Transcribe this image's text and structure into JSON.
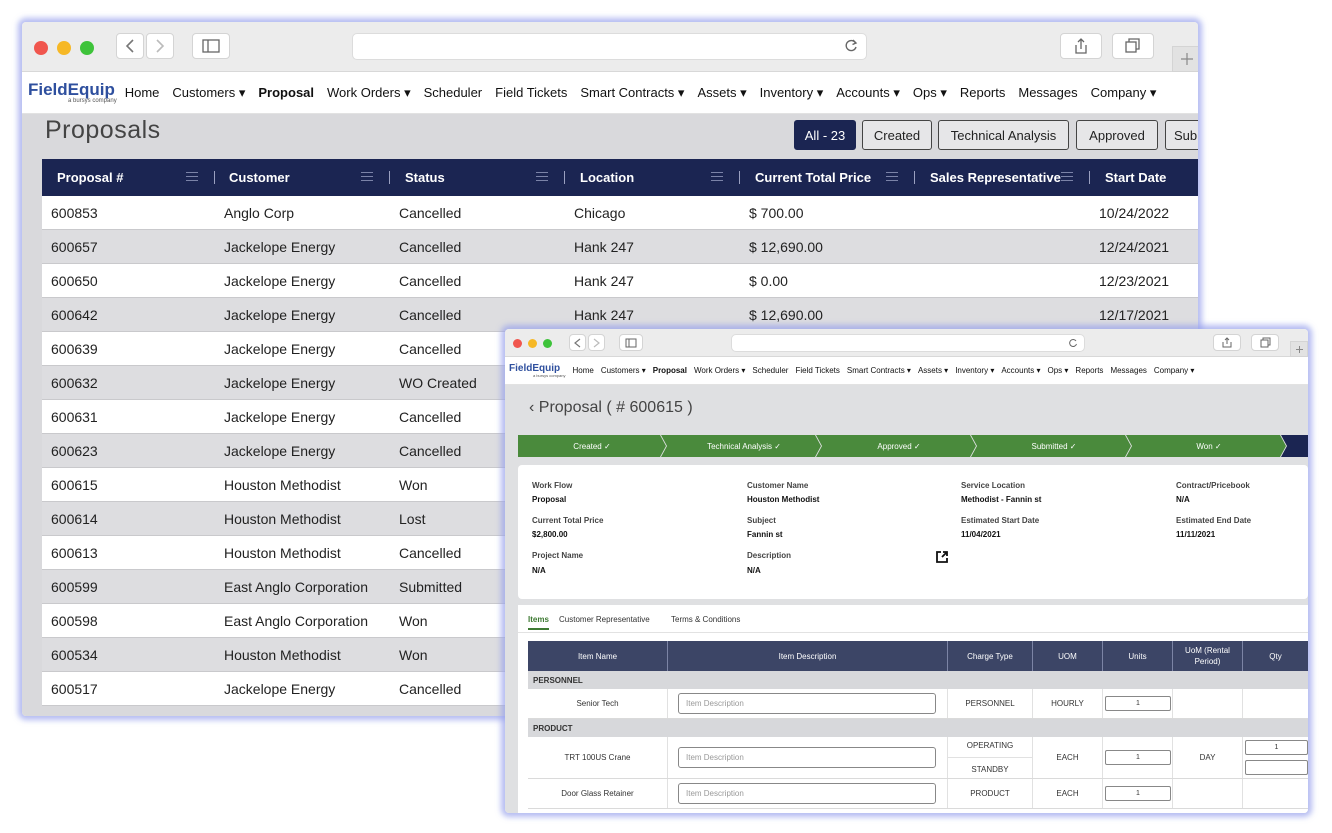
{
  "nav": {
    "logo": "FieldEquip",
    "logo_sub": "a bursys company",
    "items": [
      "Home",
      "Customers ▾",
      "Proposal",
      "Work Orders ▾",
      "Scheduler",
      "Field Tickets",
      "Smart Contracts ▾",
      "Assets ▾",
      "Inventory ▾",
      "Accounts ▾",
      "Ops ▾",
      "Reports",
      "Messages",
      "Company ▾"
    ],
    "active": "Proposal"
  },
  "list": {
    "title": "Proposals",
    "filters": [
      "All - 23",
      "Created",
      "Technical Analysis",
      "Approved",
      "Sub"
    ],
    "columns": [
      "Proposal #",
      "Customer",
      "Status",
      "Location",
      "Current Total Price",
      "Sales Representative",
      "Start Date"
    ],
    "rows": [
      [
        "600853",
        "Anglo Corp",
        "Cancelled",
        "Chicago",
        "$ 700.00",
        "",
        "10/24/2022"
      ],
      [
        "600657",
        "Jackelope Energy",
        "Cancelled",
        "Hank 247",
        "$ 12,690.00",
        "",
        "12/24/2021"
      ],
      [
        "600650",
        "Jackelope Energy",
        "Cancelled",
        "Hank 247",
        "$ 0.00",
        "",
        "12/23/2021"
      ],
      [
        "600642",
        "Jackelope Energy",
        "Cancelled",
        "Hank 247",
        "$ 12,690.00",
        "",
        "12/17/2021"
      ],
      [
        "600639",
        "Jackelope Energy",
        "Cancelled",
        "",
        "",
        "",
        ""
      ],
      [
        "600632",
        "Jackelope Energy",
        "WO Created",
        "",
        "",
        "",
        ""
      ],
      [
        "600631",
        "Jackelope Energy",
        "Cancelled",
        "",
        "",
        "",
        ""
      ],
      [
        "600623",
        "Jackelope Energy",
        "Cancelled",
        "",
        "",
        "",
        ""
      ],
      [
        "600615",
        "Houston Methodist",
        "Won",
        "",
        "",
        "",
        ""
      ],
      [
        "600614",
        "Houston Methodist",
        "Lost",
        "",
        "",
        "",
        ""
      ],
      [
        "600613",
        "Houston Methodist",
        "Cancelled",
        "",
        "",
        "",
        ""
      ],
      [
        "600599",
        "East Anglo Corporation",
        "Submitted",
        "",
        "",
        "",
        ""
      ],
      [
        "600598",
        "East Anglo Corporation",
        "Won",
        "",
        "",
        "",
        ""
      ],
      [
        "600534",
        "Houston Methodist",
        "Won",
        "",
        "",
        "",
        ""
      ],
      [
        "600517",
        "Jackelope Energy",
        "Cancelled",
        "",
        "",
        "",
        ""
      ]
    ]
  },
  "detail": {
    "back_title": "Proposal ( # 600615 )",
    "steps": [
      "Created ✓",
      "Technical Analysis ✓",
      "Approved ✓",
      "Submitted ✓",
      "Won ✓"
    ],
    "step_color": "#4a8a3c",
    "fields": [
      {
        "label": "Work Flow",
        "value": "Proposal"
      },
      {
        "label": "Customer Name",
        "value": "Houston Methodist"
      },
      {
        "label": "Service Location",
        "value": "Methodist - Fannin st"
      },
      {
        "label": "Contract/Pricebook",
        "value": "N/A"
      },
      {
        "label": "Current Total Price",
        "value": "$2,800.00"
      },
      {
        "label": "Subject",
        "value": "Fannin st"
      },
      {
        "label": "Estimated Start Date",
        "value": "11/04/2021"
      },
      {
        "label": "Estimated End Date",
        "value": "11/11/2021"
      },
      {
        "label": "Project Name",
        "value": "N/A"
      },
      {
        "label": "Description",
        "value": "N/A"
      }
    ],
    "tabs": [
      "Items",
      "Customer Representative",
      "Terms & Conditions"
    ],
    "item_columns": [
      "Item Name",
      "Item Description",
      "Charge Type",
      "UOM",
      "Units",
      "UoM (Rental Period)",
      "Qty"
    ],
    "groups": {
      "personnel": "PERSONNEL",
      "product": "PRODUCT"
    },
    "desc_placeholder": "Item Description",
    "items": [
      {
        "name": "Senior Tech",
        "charge": "PERSONNEL",
        "uom": "HOURLY",
        "units": "1",
        "rental": "",
        "qty": ""
      },
      {
        "name": "TRT 100US Crane",
        "charge": "OPERATING",
        "charge2": "STANDBY",
        "uom": "EACH",
        "units": "1",
        "rental": "DAY",
        "qty": "1"
      },
      {
        "name": "Door Glass Retainer",
        "charge": "PRODUCT",
        "uom": "EACH",
        "units": "1",
        "rental": "",
        "qty": ""
      }
    ]
  }
}
